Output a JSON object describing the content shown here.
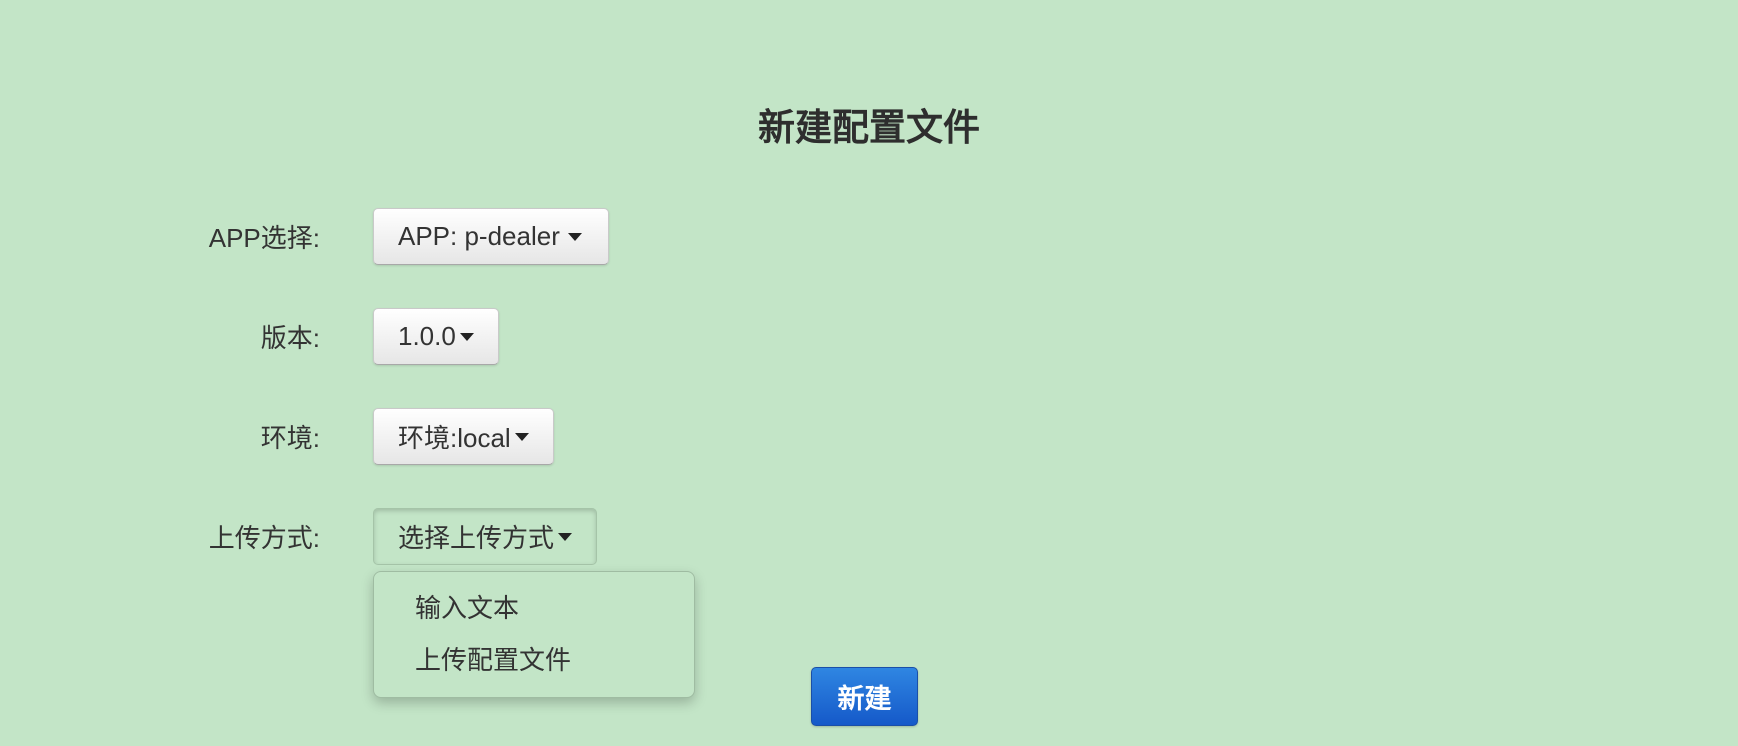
{
  "page": {
    "title": "新建配置文件"
  },
  "form": {
    "app": {
      "label": "APP选择:",
      "value": "APP: p-dealer"
    },
    "version": {
      "label": "版本:",
      "value": "1.0.0"
    },
    "env": {
      "label": "环境:",
      "value": "环境:local"
    },
    "upload": {
      "label": "上传方式:",
      "value": "选择上传方式",
      "options": [
        "输入文本",
        "上传配置文件"
      ]
    }
  },
  "actions": {
    "create_label": "新建"
  },
  "colors": {
    "background": "#c3e5c7",
    "primary_button": "#1f6fd8"
  },
  "icons": {
    "dropdown": "caret-down-icon"
  }
}
